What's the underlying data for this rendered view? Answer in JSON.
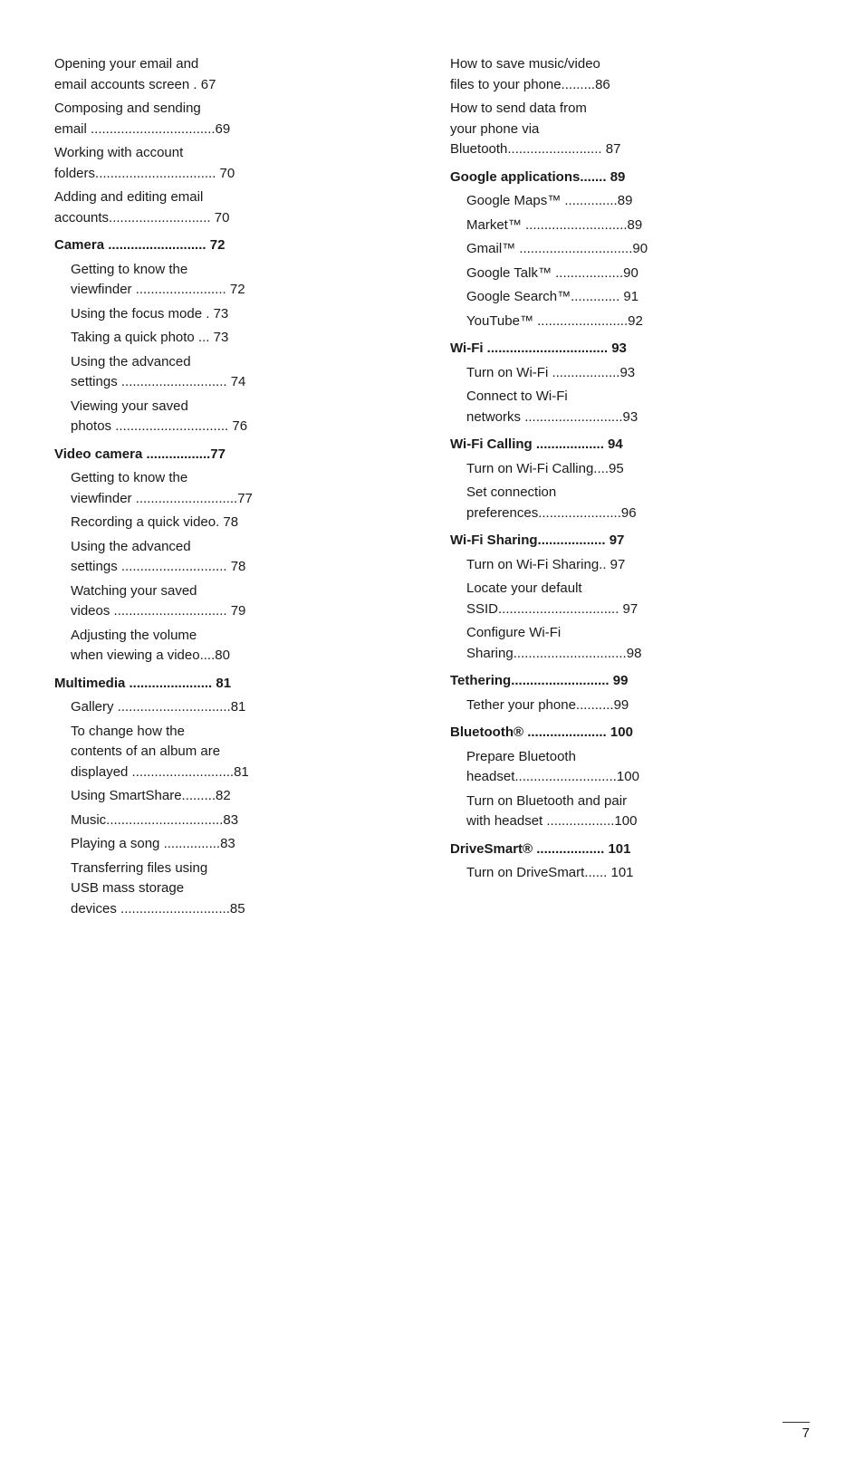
{
  "page": {
    "number": "7"
  },
  "left_column": [
    {
      "id": "entry1",
      "lines": [
        "Opening your email and",
        "email accounts screen . 67"
      ],
      "bold": false,
      "sub": false,
      "inline_number": "67",
      "text": "Opening your email and email accounts screen .",
      "multiline": true,
      "line1": "Opening your email and",
      "line2": "email accounts screen . 67"
    },
    {
      "id": "entry2",
      "bold": false,
      "sub": false,
      "text": "Composing and sending email",
      "dots": ".................................",
      "number": "69",
      "line1": "Composing and sending",
      "line2": "email .................................",
      "inline_number": "69",
      "multiline": true
    },
    {
      "id": "entry3",
      "bold": false,
      "sub": false,
      "text": "Working with account folders",
      "dots": "...............................",
      "number": "70",
      "line1": "Working with account",
      "line2": "folders................................",
      "inline_number": "70",
      "multiline": true
    },
    {
      "id": "entry4",
      "bold": false,
      "sub": false,
      "text": "Adding and editing email accounts",
      "dots": ".....................",
      "number": "70",
      "line1": "Adding and editing email",
      "line2": "accounts ........................... 70",
      "inline_number": "70",
      "multiline": true
    },
    {
      "id": "camera",
      "bold": true,
      "sub": false,
      "text": "Camera",
      "dots": ".........................",
      "number": "72"
    },
    {
      "id": "entry5",
      "bold": false,
      "sub": true,
      "text": "Getting to know the viewfinder",
      "dots": "........................",
      "number": "72",
      "line1": "Getting to know the",
      "line2": "viewfinder ........................ 72",
      "multiline": true
    },
    {
      "id": "entry6",
      "bold": false,
      "sub": true,
      "text": "Using the focus mode . 73"
    },
    {
      "id": "entry7",
      "bold": false,
      "sub": true,
      "text": "Taking a quick photo  ... 73"
    },
    {
      "id": "entry8",
      "bold": false,
      "sub": true,
      "text": "Using the advanced settings",
      "dots": "............................",
      "number": "74",
      "line1": "Using the advanced",
      "line2": "settings ............................ 74",
      "multiline": true
    },
    {
      "id": "entry9",
      "bold": false,
      "sub": true,
      "text": "Viewing your saved photos",
      "dots": "..............................",
      "number": "76",
      "line1": "Viewing your saved",
      "line2": "photos .............................. 76",
      "multiline": true
    },
    {
      "id": "video-camera",
      "bold": true,
      "sub": false,
      "text": "Video camera",
      "dots": ".................",
      "number": "77"
    },
    {
      "id": "entry10",
      "bold": false,
      "sub": true,
      "text": "Getting to know the viewfinder",
      "dots": "...........................",
      "number": "77",
      "line1": "Getting to know the",
      "line2": "viewfinder ...........................77",
      "multiline": true
    },
    {
      "id": "entry11",
      "bold": false,
      "sub": true,
      "text": "Recording a quick video. 78"
    },
    {
      "id": "entry12",
      "bold": false,
      "sub": true,
      "text": "Using the advanced settings",
      "dots": "............................",
      "number": "78",
      "line1": "Using the advanced",
      "line2": "settings ............................ 78",
      "multiline": true
    },
    {
      "id": "entry13",
      "bold": false,
      "sub": true,
      "text": "Watching your saved videos",
      "dots": "..............................",
      "number": "79",
      "line1": "Watching your saved",
      "line2": "videos .............................. 79",
      "multiline": true
    },
    {
      "id": "entry14",
      "bold": false,
      "sub": true,
      "text": "Adjusting the volume when viewing a video....80",
      "line1": "Adjusting the volume",
      "line2": "when viewing a video....80",
      "multiline": true
    },
    {
      "id": "multimedia",
      "bold": true,
      "sub": false,
      "text": "Multimedia",
      "dots": ".......................",
      "number": "81"
    },
    {
      "id": "entry15",
      "bold": false,
      "sub": true,
      "text": "Gallery ..............................81"
    },
    {
      "id": "entry16",
      "bold": false,
      "sub": true,
      "text": "To change how the contents of an album are displayed",
      "dots": ".....................",
      "number": "81",
      "line1": "To change how the",
      "line2": "contents of an album are",
      "line3": "displayed ...........................81",
      "multiline": true,
      "three_lines": true
    },
    {
      "id": "entry17",
      "bold": false,
      "sub": true,
      "text": "Using SmartShare.........82"
    },
    {
      "id": "entry18",
      "bold": false,
      "sub": true,
      "text": "Music...............................83"
    },
    {
      "id": "entry19",
      "bold": false,
      "sub": true,
      "text": "Playing a song ...............83"
    },
    {
      "id": "entry20",
      "bold": false,
      "sub": true,
      "text": "Transferring files using USB mass storage devices",
      "dots": ".....................",
      "number": "85",
      "line1": "Transferring files using",
      "line2": "USB mass storage",
      "line3": "devices .............................85",
      "multiline": true,
      "three_lines": true
    }
  ],
  "right_column": [
    {
      "id": "entry21",
      "bold": false,
      "sub": false,
      "text": "How to save music/video files to your phone.........86",
      "line1": "How to save music/video",
      "line2": "files to your phone.........86",
      "multiline": true
    },
    {
      "id": "entry22",
      "bold": false,
      "sub": false,
      "text": "How to send data from your phone via Bluetooth",
      "dots": "..........................",
      "number": "87",
      "line1": "How to send data from",
      "line2": "your phone via",
      "line3": "Bluetooth......................... 87",
      "multiline": true,
      "three_lines": true
    },
    {
      "id": "google-apps",
      "bold": true,
      "sub": false,
      "text": "Google applications....... 89"
    },
    {
      "id": "entry23",
      "bold": false,
      "sub": true,
      "text": "Google Maps™ ..............89"
    },
    {
      "id": "entry24",
      "bold": false,
      "sub": true,
      "text": "Market™ ...........................89"
    },
    {
      "id": "entry25",
      "bold": false,
      "sub": true,
      "text": "Gmail™ ..............................90"
    },
    {
      "id": "entry26",
      "bold": false,
      "sub": true,
      "text": "Google Talk™ ..................90"
    },
    {
      "id": "entry27",
      "bold": false,
      "sub": true,
      "text": "Google Search™............. 91"
    },
    {
      "id": "entry28",
      "bold": false,
      "sub": true,
      "text": "YouTube™ ........................92"
    },
    {
      "id": "wifi",
      "bold": true,
      "sub": false,
      "text": "Wi-Fi ................................ 93"
    },
    {
      "id": "entry29",
      "bold": false,
      "sub": true,
      "text": "Turn on Wi-Fi ..................93"
    },
    {
      "id": "entry30",
      "bold": false,
      "sub": true,
      "text": "Connect to Wi-Fi networks",
      "dots": "..........................",
      "number": "93",
      "line1": "Connect to Wi-Fi",
      "line2": "networks ..........................93",
      "multiline": true
    },
    {
      "id": "wifi-calling",
      "bold": true,
      "sub": false,
      "text": "Wi-Fi Calling .................. 94"
    },
    {
      "id": "entry31",
      "bold": false,
      "sub": true,
      "text": "Turn on Wi-Fi Calling....95"
    },
    {
      "id": "entry32",
      "bold": false,
      "sub": true,
      "text": "Set connection preferences",
      "dots": ".......................",
      "number": "96",
      "line1": "Set connection",
      "line2": "preferences......................96",
      "multiline": true
    },
    {
      "id": "wifi-sharing",
      "bold": true,
      "sub": false,
      "text": "Wi-Fi Sharing.................. 97"
    },
    {
      "id": "entry33",
      "bold": false,
      "sub": true,
      "text": "Turn on Wi-Fi Sharing.. 97"
    },
    {
      "id": "entry34",
      "bold": false,
      "sub": true,
      "text": "Locate your default SSID",
      "dots": "................................",
      "number": "97",
      "line1": "Locate your default",
      "line2": "SSID................................ 97",
      "multiline": true
    },
    {
      "id": "entry35",
      "bold": false,
      "sub": true,
      "text": "Configure Wi-Fi Sharing",
      "dots": "..............................",
      "number": "98",
      "line1": "Configure Wi-Fi",
      "line2": "Sharing..............................98",
      "multiline": true
    },
    {
      "id": "tethering",
      "bold": true,
      "sub": false,
      "text": "Tethering.......................... 99"
    },
    {
      "id": "entry36",
      "bold": false,
      "sub": true,
      "text": "Tether your phone..........99"
    },
    {
      "id": "bluetooth",
      "bold": true,
      "sub": false,
      "text": "Bluetooth® ..................... 100"
    },
    {
      "id": "entry37",
      "bold": false,
      "sub": true,
      "text": "Prepare Bluetooth headset",
      "dots": "...........................",
      "number": "100",
      "line1": "Prepare Bluetooth",
      "line2": "headset...........................100",
      "multiline": true
    },
    {
      "id": "entry38",
      "bold": false,
      "sub": true,
      "text": "Turn on Bluetooth and pair with headset",
      "dots": ".................",
      "number": "100",
      "line1": "Turn on Bluetooth and pair",
      "line2": "with headset ..................100",
      "multiline": true
    },
    {
      "id": "drivesmart",
      "bold": true,
      "sub": false,
      "text": "DriveSmart® .................. 101"
    },
    {
      "id": "entry39",
      "bold": false,
      "sub": true,
      "text": "Turn on DriveSmart...... 101"
    }
  ]
}
